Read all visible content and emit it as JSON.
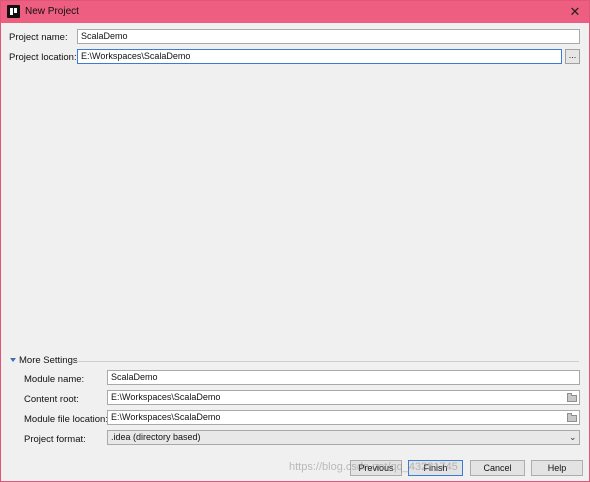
{
  "window": {
    "title": "New Project",
    "close_glyph": "✕"
  },
  "form": {
    "project_name_label": "Project name:",
    "project_name_value": "ScalaDemo",
    "project_location_label": "Project location:",
    "project_location_value": "E:\\Workspaces\\ScalaDemo",
    "browse_label": "..."
  },
  "more_settings": {
    "header": "More Settings",
    "module_name_label": "Module name:",
    "module_name_value": "ScalaDemo",
    "content_root_label": "Content root:",
    "content_root_value": "E:\\Workspaces\\ScalaDemo",
    "module_file_location_label": "Module file location:",
    "module_file_location_value": "E:\\Workspaces\\ScalaDemo",
    "project_format_label": "Project format:",
    "project_format_value": ".idea (directory based)"
  },
  "buttons": {
    "previous": "Previous",
    "finish": "Finish",
    "cancel": "Cancel",
    "help": "Help"
  },
  "watermark": "https://blog.csdn.net/qq_43231745",
  "colors": {
    "titlebar": "#ed5e80",
    "focus_border": "#3d7bd4"
  }
}
